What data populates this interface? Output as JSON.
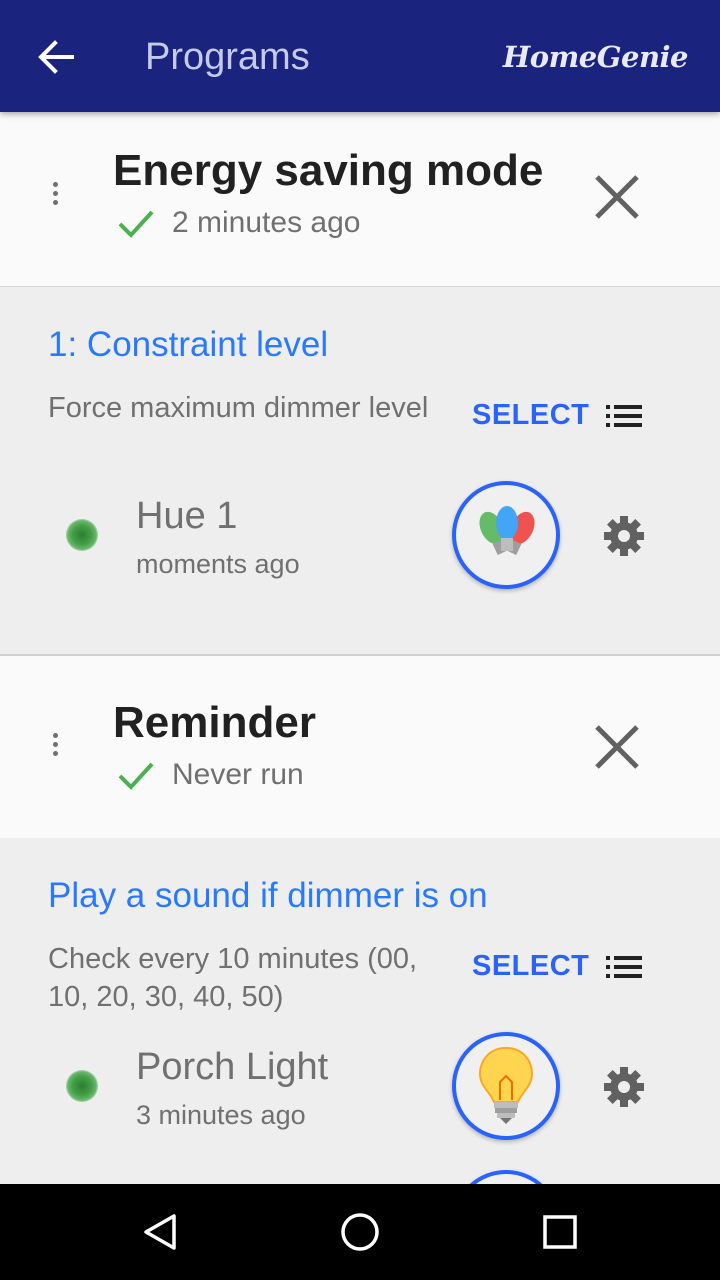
{
  "appbar": {
    "title": "Programs",
    "brand": "HomeGenie",
    "back_icon": "arrow-back-icon"
  },
  "colors": {
    "appbar": "#1a237e",
    "accent": "#2962ff",
    "check": "#4caf50"
  },
  "programs": [
    {
      "title": "Energy saving mode",
      "status": "2 minutes ago",
      "section_title": "1: Constraint level",
      "description": "Force maximum dimmer level",
      "select_label": "SELECT",
      "device": {
        "name": "Hue 1",
        "time": "moments ago",
        "icon": "colored-bulbs-icon"
      }
    },
    {
      "title": "Reminder",
      "status": "Never run",
      "section_title": "Play a sound if dimmer is on",
      "description": "Check every 10 minutes (00, 10, 20, 30, 40, 50)",
      "select_label": "SELECT",
      "device": {
        "name": "Porch Light",
        "time": "3 minutes ago",
        "icon": "light-bulb-icon"
      }
    }
  ],
  "navbar": {
    "icons": [
      "back-triangle-icon",
      "home-circle-icon",
      "recents-square-icon"
    ]
  }
}
